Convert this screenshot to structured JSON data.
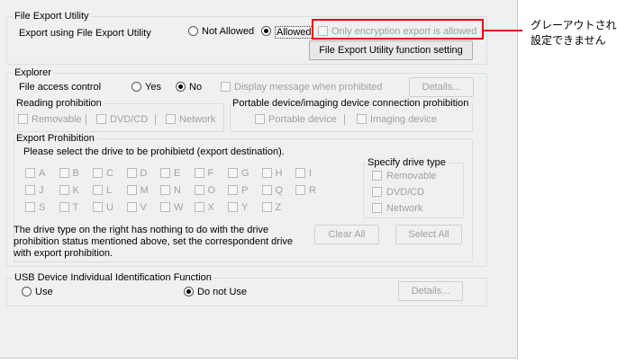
{
  "file_export": {
    "group_title": "File Export Utility",
    "label": "Export using File Export Utility",
    "opt_not_allowed": "Not Allowed",
    "opt_allowed": "Allowed",
    "only_encryption": "Only encryption export is allowed",
    "setting_button": "File Export Utility function setting"
  },
  "explorer": {
    "group_title": "Explorer",
    "file_access_label": "File access control",
    "opt_yes": "Yes",
    "opt_no": "No",
    "display_message": "Display message when prohibited",
    "details_button": "Details...",
    "reading": {
      "title": "Reading prohibition",
      "removable": "Removable",
      "dvdcd": "DVD/CD",
      "network": "Network"
    },
    "portable": {
      "title": "Portable device/imaging device connection prohibition",
      "portable_device": "Portable device",
      "imaging_device": "Imaging device"
    },
    "export": {
      "title": "Export Prohibition",
      "instruction": "Please select the drive to be prohibietd (export destination).",
      "drives_row1": [
        "A",
        "B",
        "C",
        "D",
        "E",
        "F",
        "G",
        "H",
        "I"
      ],
      "drives_row2": [
        "J",
        "K",
        "L",
        "M",
        "N",
        "O",
        "P",
        "Q",
        "R"
      ],
      "drives_row3": [
        "S",
        "T",
        "U",
        "V",
        "W",
        "X",
        "Y",
        "Z"
      ],
      "drive_type": {
        "title": "Specify drive type",
        "removable": "Removable",
        "dvdcd": "DVD/CD",
        "network": "Network"
      },
      "note_line1": "The drive type on the right has nothing to do with the drive",
      "note_line2": "prohibition status mentioned above, set the correspondent drive",
      "note_line3": "with export prohibition.",
      "clear_all": "Clear All",
      "select_all": "Select All"
    }
  },
  "usb": {
    "group_title": "USB Device Individual Identification Function",
    "opt_use": "Use",
    "opt_do_not_use": "Do not Use",
    "details_button": "Details..."
  },
  "annotation": {
    "line1": "グレーアウトされ",
    "line2": "設定できません",
    "color": "#e60012"
  }
}
